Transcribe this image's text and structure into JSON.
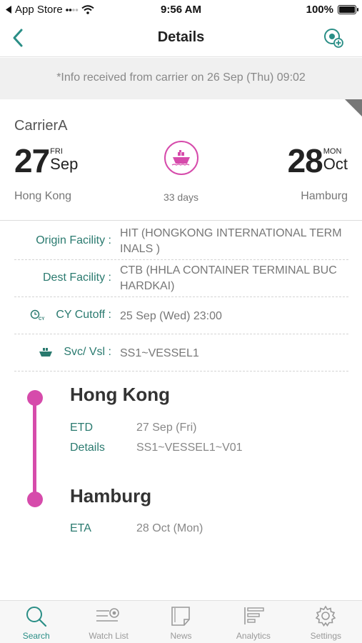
{
  "status_bar": {
    "back_app": "App Store",
    "time": "9:56 AM",
    "battery": "100%"
  },
  "nav": {
    "title": "Details"
  },
  "info_banner": "*Info received from carrier on 26 Sep (Thu) 09:02",
  "summary": {
    "carrier": "CarrierA",
    "departure": {
      "day": "27",
      "dow": "FRI",
      "month": "Sep",
      "city": "Hong Kong"
    },
    "arrival": {
      "day": "28",
      "dow": "MON",
      "month": "Oct",
      "city": "Hamburg"
    },
    "duration": "33 days"
  },
  "details": {
    "origin_label": "Origin Facility :",
    "origin_value": "HIT (HONGKONG INTERNATIONAL TERM INALS )",
    "dest_label": "Dest Facility :",
    "dest_value": "CTB (HHLA CONTAINER TERMINAL BUC HARDKAI)",
    "cutoff_label": "CY Cutoff :",
    "cutoff_value": "25 Sep (Wed) 23:00",
    "svc_label": "Svc/ Vsl :",
    "svc_value": "SS1~VESSEL1"
  },
  "route": {
    "origin": {
      "name": "Hong Kong",
      "etd_label": "ETD",
      "etd_value": "27 Sep (Fri)",
      "details_label": "Details",
      "details_value": "SS1~VESSEL1~V01"
    },
    "destination": {
      "name": "Hamburg",
      "eta_label": "ETA",
      "eta_value": "28 Oct (Mon)"
    }
  },
  "tabs": [
    {
      "label": "Search",
      "icon": "search-icon",
      "active": true
    },
    {
      "label": "Watch List",
      "icon": "watch-list-icon",
      "active": false
    },
    {
      "label": "News",
      "icon": "news-icon",
      "active": false
    },
    {
      "label": "Analytics",
      "icon": "analytics-icon",
      "active": false
    },
    {
      "label": "Settings",
      "icon": "settings-icon",
      "active": false
    }
  ],
  "colors": {
    "accent": "#2a8e86",
    "route": "#d64bab",
    "label_green": "#2a7a6f"
  }
}
